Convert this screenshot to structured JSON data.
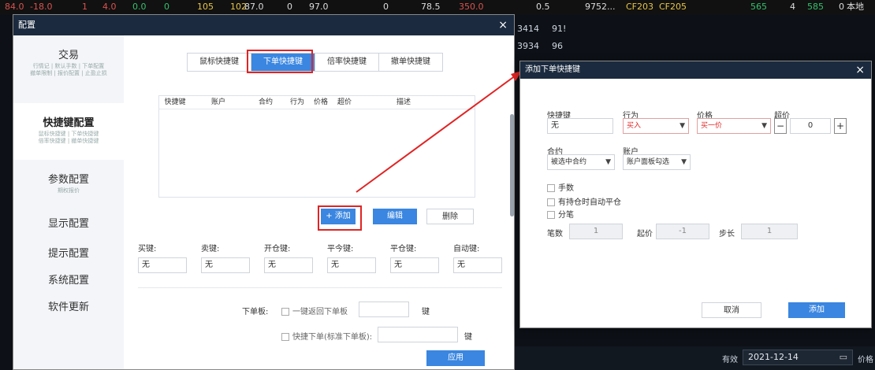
{
  "ticker": {
    "items": [
      "84.0",
      "-18.0",
      "1",
      "4.0",
      "0.0",
      "0",
      "105",
      "102",
      "87.0",
      "0",
      "97.0",
      "0",
      "78.5",
      "350.0",
      "0.5",
      "9752...",
      "CF203",
      "CF205",
      "565",
      "4",
      "585",
      "0",
      "本地"
    ]
  },
  "background": {
    "rows": [
      [
        "3414",
        "91!"
      ],
      [
        "3934",
        "96"
      ]
    ],
    "date_label": "有效",
    "date_value": "2021-12-14",
    "price_label": "价格"
  },
  "main_dialog": {
    "title": "配置",
    "close": "×",
    "sidebar": [
      {
        "title": "交易",
        "sub": "行情记 | 默认手数 | 下单配置\n撤单限制 | 报价配置 | 止盈止损"
      },
      {
        "title": "快捷键配置",
        "sub": "鼠标快捷键 | 下单快捷键\n倍率快捷键 | 撤单快捷键"
      },
      {
        "title": "参数配置",
        "sub": "期权报价"
      },
      {
        "title": "显示配置",
        "sub": ""
      },
      {
        "title": "提示配置",
        "sub": ""
      },
      {
        "title": "系统配置",
        "sub": ""
      },
      {
        "title": "软件更新",
        "sub": ""
      }
    ],
    "tabs": [
      "鼠标快捷键",
      "下单快捷键",
      "倍率快捷键",
      "撤单快捷键"
    ],
    "active_tab": 1,
    "table_headers": [
      "快捷键",
      "账户",
      "合约",
      "行为",
      "价格",
      "超价",
      "描述"
    ],
    "buttons": {
      "add": "+ 添加",
      "edit": "编辑",
      "delete": "删除",
      "apply": "应用"
    },
    "keys": [
      {
        "label": "买键:",
        "value": "无"
      },
      {
        "label": "卖键:",
        "value": "无"
      },
      {
        "label": "开仓键:",
        "value": "无"
      },
      {
        "label": "平今键:",
        "value": "无"
      },
      {
        "label": "平仓键:",
        "value": "无"
      },
      {
        "label": "自动键:",
        "value": "无"
      }
    ],
    "order_board_label": "下单板:",
    "one_key_return": "一键返回下单板",
    "key_suffix": "键",
    "quick_order": "快捷下单(标准下单板):",
    "key_suffix2": "键"
  },
  "popup": {
    "title": "添加下单快捷键",
    "close": "×",
    "labels": {
      "hotkey": "快捷键",
      "action": "行为",
      "price": "价格",
      "overprice": "超价",
      "contract": "合约",
      "account": "账户",
      "lots": "笔数",
      "start_price": "起价",
      "step": "步长"
    },
    "hotkey_value": "无",
    "action_value": "买入",
    "price_value": "买一价",
    "overprice_value": "0",
    "minus": "−",
    "plus": "+",
    "contract_value": "被选中合约",
    "account_value": "账户面板勾选",
    "checks": [
      "手数",
      "有持仓时自动平仓",
      "分笔"
    ],
    "lots_value": "1",
    "start_price_value": "-1",
    "step_value": "1",
    "cancel": "取消",
    "add": "添加"
  },
  "colors": {
    "accent": "#3a86e0",
    "highlight": "#e02424",
    "title_bar": "#1b2a3e"
  }
}
